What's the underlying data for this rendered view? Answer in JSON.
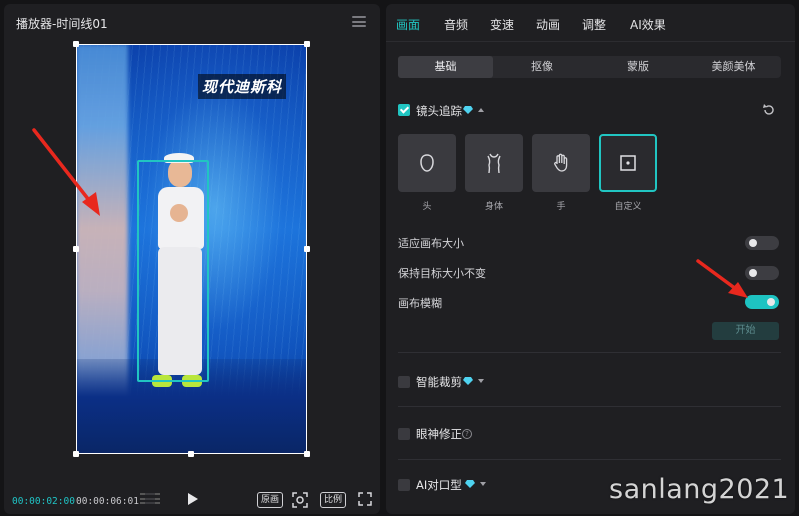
{
  "player": {
    "title": "播放器-时间线01",
    "caption": "现代迪斯科",
    "current_time": "00:00:02:00",
    "total_time": "00:00:06:01",
    "btn_original": "原画",
    "btn_ratio": "比例"
  },
  "tabs": [
    "画面",
    "音频",
    "变速",
    "动画",
    "调整",
    "AI效果"
  ],
  "active_tab": 0,
  "subtabs": [
    "基础",
    "抠像",
    "蒙版",
    "美颜美体"
  ],
  "active_subtab": 0,
  "camera_tracking": {
    "label": "镜头追踪",
    "checked": true,
    "modes": [
      {
        "label": "头",
        "icon": "head-icon"
      },
      {
        "label": "身体",
        "icon": "body-icon"
      },
      {
        "label": "手",
        "icon": "hand-icon"
      },
      {
        "label": "自定义",
        "icon": "custom-icon"
      }
    ],
    "selected_mode": 3,
    "options": [
      {
        "label": "适应画布大小",
        "on": false
      },
      {
        "label": "保持目标大小不变",
        "on": false
      },
      {
        "label": "画布模糊",
        "on": true
      }
    ],
    "start_label": "开始"
  },
  "sections": [
    {
      "label": "智能裁剪",
      "checked": false,
      "gem": true,
      "caret": true
    },
    {
      "label": "眼神修正",
      "checked": false,
      "help": true
    },
    {
      "label": "AI对口型",
      "checked": false,
      "gem": true,
      "caret": true
    }
  ],
  "watermark": "sanlang2021",
  "colors": {
    "accent": "#21c5c2",
    "arrow": "#e8281e",
    "gem": "#4fd3f0"
  }
}
